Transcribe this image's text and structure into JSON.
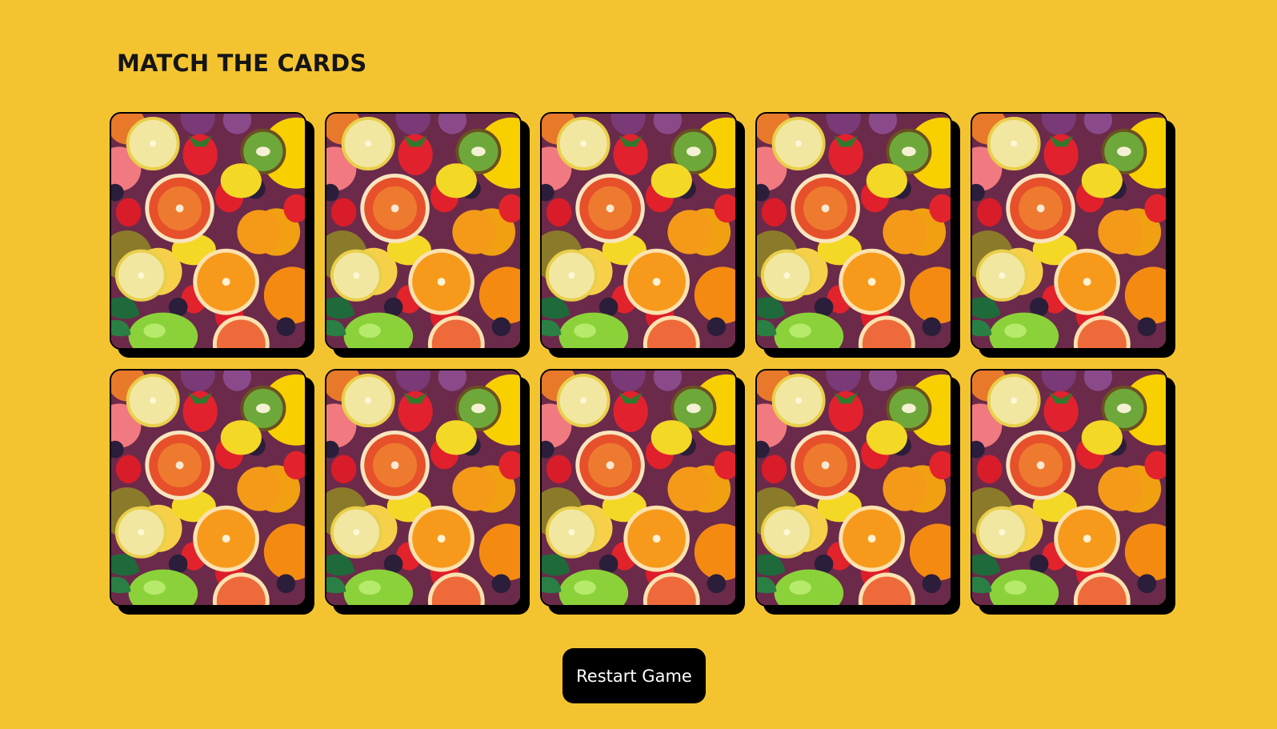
{
  "game": {
    "title": "MATCH THE CARDS",
    "restart_label": "Restart Game"
  },
  "board": {
    "rows": 2,
    "columns": 5,
    "cards": [
      {
        "face": "hidden",
        "back_image": "fruit-pattern"
      },
      {
        "face": "hidden",
        "back_image": "fruit-pattern"
      },
      {
        "face": "hidden",
        "back_image": "fruit-pattern"
      },
      {
        "face": "hidden",
        "back_image": "fruit-pattern"
      },
      {
        "face": "hidden",
        "back_image": "fruit-pattern"
      },
      {
        "face": "hidden",
        "back_image": "fruit-pattern"
      },
      {
        "face": "hidden",
        "back_image": "fruit-pattern"
      },
      {
        "face": "hidden",
        "back_image": "fruit-pattern"
      },
      {
        "face": "hidden",
        "back_image": "fruit-pattern"
      },
      {
        "face": "hidden",
        "back_image": "fruit-pattern"
      }
    ]
  },
  "colors": {
    "background": "#f4c430",
    "card_border": "#000000",
    "button_background": "#000000",
    "button_text": "#ffffff"
  }
}
